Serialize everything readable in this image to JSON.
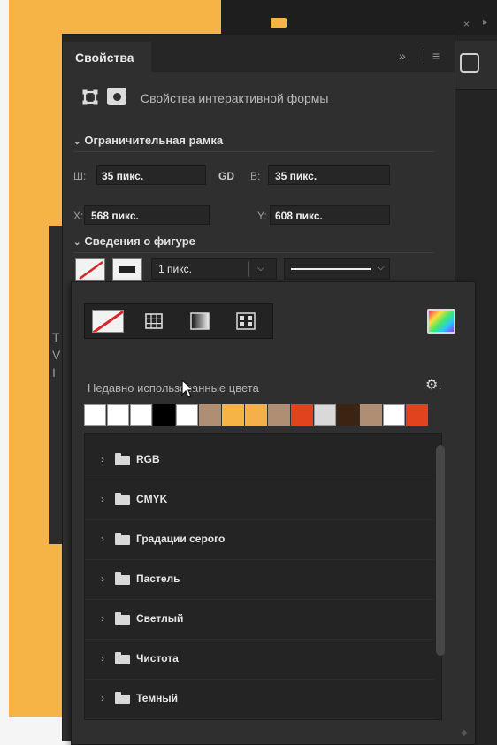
{
  "panel": {
    "tab_title": "Свойства",
    "expand_glyph": "»",
    "menu_glyph": "≡",
    "interactive_form_label": "Свойства интерактивной формы"
  },
  "bounds": {
    "title": "Ограничительная рамка",
    "w_label": "Ш:",
    "w_value": "35 пикс.",
    "link_glyph": "GD",
    "h_label": "В:",
    "h_value": "35 пикс.",
    "x_label": "X:",
    "x_value": "568 пикс.",
    "y_label": "Y:",
    "y_value": "608 пикс."
  },
  "shape": {
    "title": "Сведения о фигуре",
    "stroke_width": "1 пикс."
  },
  "colors": {
    "recent_label": "Недавно использованные цвета",
    "swatches": [
      "#ffffff",
      "#ffffff",
      "#ffffff",
      "#000000",
      "#ffffff",
      "#b08e74",
      "#f7b446",
      "#f5b04a",
      "#b08e74",
      "#e0431e",
      "#d9d9d9",
      "#3b2412",
      "#b08e74",
      "#ffffff",
      "#e0431e"
    ],
    "folders": [
      "RGB",
      "CMYK",
      "Градации серого",
      "Пастель",
      "Светлый",
      "Чистота",
      "Темный"
    ]
  },
  "icons": {
    "gear": "⚙",
    "chevron_down": "⌄",
    "chevron_right": "›",
    "close": "×",
    "caret_down": "⌵"
  }
}
